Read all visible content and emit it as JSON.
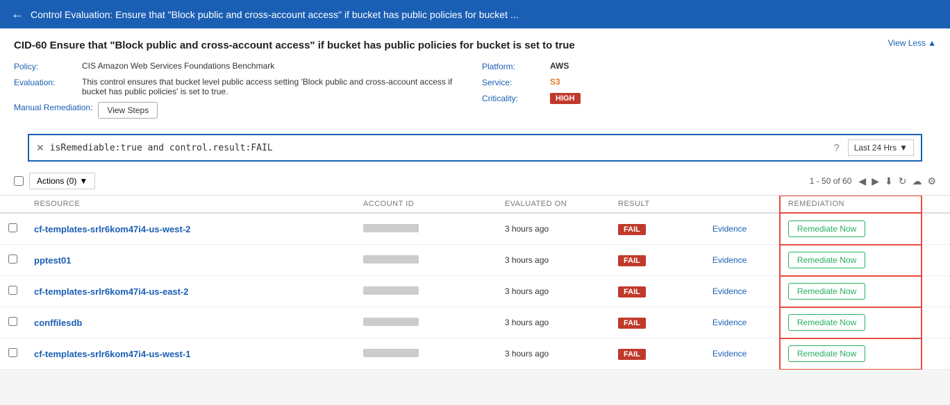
{
  "header": {
    "back_label": "←",
    "title": "Control Evaluation: Ensure that \"Block public and cross-account access\" if bucket has public policies for bucket ..."
  },
  "page": {
    "title": "CID-60 Ensure that \"Block public and cross-account access\" if bucket has public policies for bucket is set to true",
    "view_less_label": "View Less",
    "view_less_icon": "▲"
  },
  "meta_left": {
    "policy_label": "Policy:",
    "policy_value": "CIS Amazon Web Services Foundations Benchmark",
    "evaluation_label": "Evaluation:",
    "evaluation_value": "This control ensures that bucket level public access setting 'Block public and cross-account access if bucket has public policies' is set to true.",
    "remediation_label": "Manual Remediation:",
    "view_steps_label": "View Steps"
  },
  "meta_right": {
    "platform_label": "Platform:",
    "platform_value": "AWS",
    "service_label": "Service:",
    "service_value": "S3",
    "criticality_label": "Criticality:",
    "criticality_value": "HIGH"
  },
  "search": {
    "close_icon": "✕",
    "query": "isRemediable:true and control.result:FAIL",
    "info_icon": "?",
    "time_label": "Last 24 Hrs",
    "dropdown_icon": "▼"
  },
  "toolbar": {
    "actions_label": "Actions (0)",
    "actions_icon": "▼",
    "pagination": "1 - 50 of 60",
    "prev_icon": "◀",
    "next_icon": "▶",
    "download_icon": "⬇",
    "refresh_icon": "↻",
    "cloud_icon": "☁",
    "settings_icon": "⚙"
  },
  "table": {
    "columns": [
      "",
      "RESOURCE",
      "ACCOUNT ID",
      "EVALUATED ON",
      "RESULT",
      "",
      "REMEDIATION"
    ],
    "rows": [
      {
        "resource": "cf-templates-srlr6kom47i4-us-west-2",
        "account_id": "blurred",
        "evaluated_on": "3 hours ago",
        "result": "FAIL",
        "evidence": "Evidence",
        "remediation": "Remediate Now"
      },
      {
        "resource": "pptest01",
        "account_id": "blurred",
        "evaluated_on": "3 hours ago",
        "result": "FAIL",
        "evidence": "Evidence",
        "remediation": "Remediate Now"
      },
      {
        "resource": "cf-templates-srlr6kom47i4-us-east-2",
        "account_id": "blurred",
        "evaluated_on": "3 hours ago",
        "result": "FAIL",
        "evidence": "Evidence",
        "remediation": "Remediate Now"
      },
      {
        "resource": "conffilesdb",
        "account_id": "blurred",
        "evaluated_on": "3 hours ago",
        "result": "FAIL",
        "evidence": "Evidence",
        "remediation": "Remediate Now"
      },
      {
        "resource": "cf-templates-srlr6kom47i4-us-west-1",
        "account_id": "blurred",
        "evaluated_on": "3 hours ago",
        "result": "FAIL",
        "evidence": "Evidence",
        "remediation": "Remediate Now"
      }
    ]
  }
}
